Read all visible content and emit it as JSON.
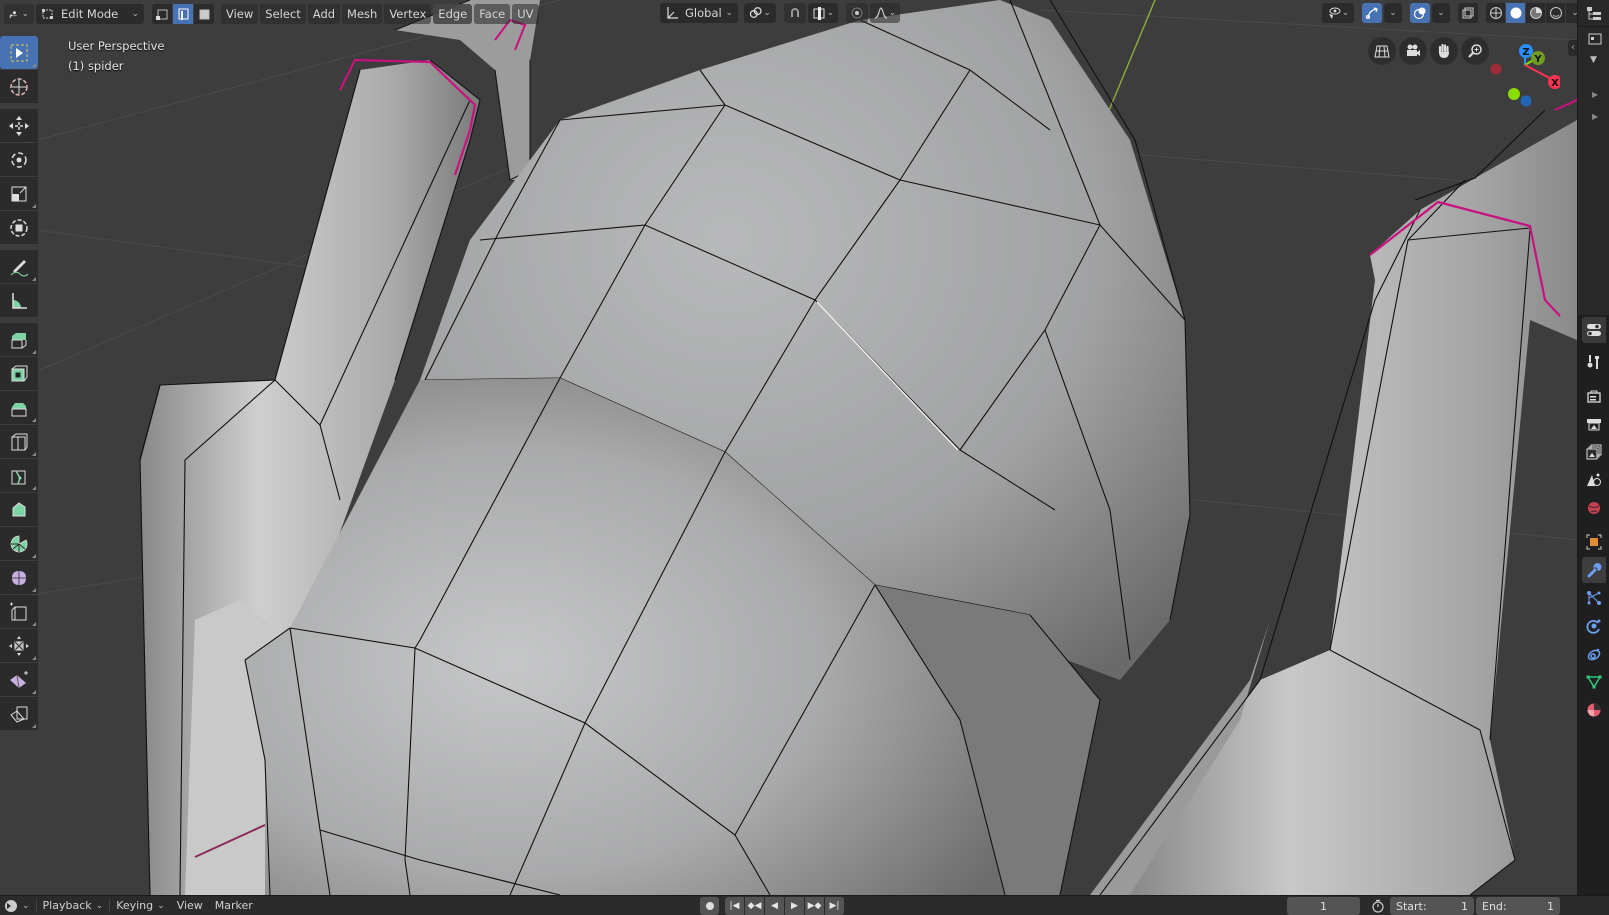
{
  "header": {
    "editor_type_icon": "3d-viewport-icon",
    "mode": "Edit Mode",
    "select_modes": [
      {
        "name": "vertex-select",
        "active": false
      },
      {
        "name": "edge-select",
        "active": true
      },
      {
        "name": "face-select",
        "active": false
      }
    ],
    "menus": [
      "View",
      "Select",
      "Add",
      "Mesh",
      "Vertex",
      "Edge",
      "Face",
      "UV"
    ],
    "active_menu": "Edge",
    "transform_orientation": "Global",
    "pivot_icon": "pivot-link-icon",
    "snap_icon": "snap-magnet-icon",
    "snap_target_icon": "snap-increment-icon",
    "proportional_icon": "proportional-edit-icon",
    "falloff_icon": "falloff-curve-icon",
    "right_controls": [
      "visibility-eye-icon",
      "gizmo-toggle-icon",
      "overlay-toggle-icon",
      "xray-toggle-icon",
      "shading-wireframe-icon",
      "shading-solid-icon",
      "shading-material-icon",
      "shading-rendered-icon"
    ],
    "active_shading": "solid"
  },
  "overlay": {
    "view_name": "User Perspective",
    "object_info": "(1) spider"
  },
  "navigation": {
    "buttons": [
      "toggle-ortho-grid-icon",
      "camera-view-icon",
      "pan-hand-icon",
      "zoom-magnifier-icon"
    ],
    "axes": {
      "x": "X",
      "y": "Y",
      "z": "Z"
    },
    "colors": {
      "x": "#ff3352",
      "y": "#8bdc00",
      "z": "#2890ff"
    }
  },
  "toolbar": {
    "tools": [
      {
        "name": "select-box",
        "active": true
      },
      {
        "name": "cursor",
        "active": false
      },
      {
        "name": "move",
        "active": false
      },
      {
        "name": "rotate",
        "active": false
      },
      {
        "name": "scale",
        "active": false
      },
      {
        "name": "transform",
        "active": false
      },
      {
        "name": "annotate",
        "active": false
      },
      {
        "name": "measure",
        "active": false
      },
      {
        "name": "extrude-region",
        "active": false
      },
      {
        "name": "inset-faces",
        "active": false
      },
      {
        "name": "bevel",
        "active": false
      },
      {
        "name": "loop-cut",
        "active": false
      },
      {
        "name": "knife",
        "active": false
      },
      {
        "name": "poly-build",
        "active": false
      },
      {
        "name": "spin",
        "active": false
      },
      {
        "name": "smooth",
        "active": false
      },
      {
        "name": "edge-slide",
        "active": false
      },
      {
        "name": "shrink-fatten",
        "active": false
      },
      {
        "name": "shear",
        "active": false
      },
      {
        "name": "rip-region",
        "active": false
      }
    ]
  },
  "properties_tabs": [
    {
      "name": "tool",
      "active": false
    },
    {
      "name": "render",
      "active": false
    },
    {
      "name": "output",
      "active": false
    },
    {
      "name": "view-layer",
      "active": false
    },
    {
      "name": "scene",
      "active": false
    },
    {
      "name": "world",
      "active": false
    },
    {
      "name": "object",
      "active": false
    },
    {
      "name": "modifiers",
      "active": true
    },
    {
      "name": "particles",
      "active": false
    },
    {
      "name": "physics",
      "active": false
    },
    {
      "name": "constraints",
      "active": false
    },
    {
      "name": "data",
      "active": false
    },
    {
      "name": "material",
      "active": false
    }
  ],
  "timeline": {
    "menus": [
      "Playback",
      "Keying",
      "View",
      "Marker"
    ],
    "current_frame": "1",
    "start_label": "Start:",
    "start_value": "1",
    "end_label": "End:",
    "end_value": "1"
  },
  "colors": {
    "accent": "#4772b3",
    "seam": "#c8127f",
    "viewport_bg": "#3d3d3d",
    "mesh_surface": "#b4b4b4"
  }
}
